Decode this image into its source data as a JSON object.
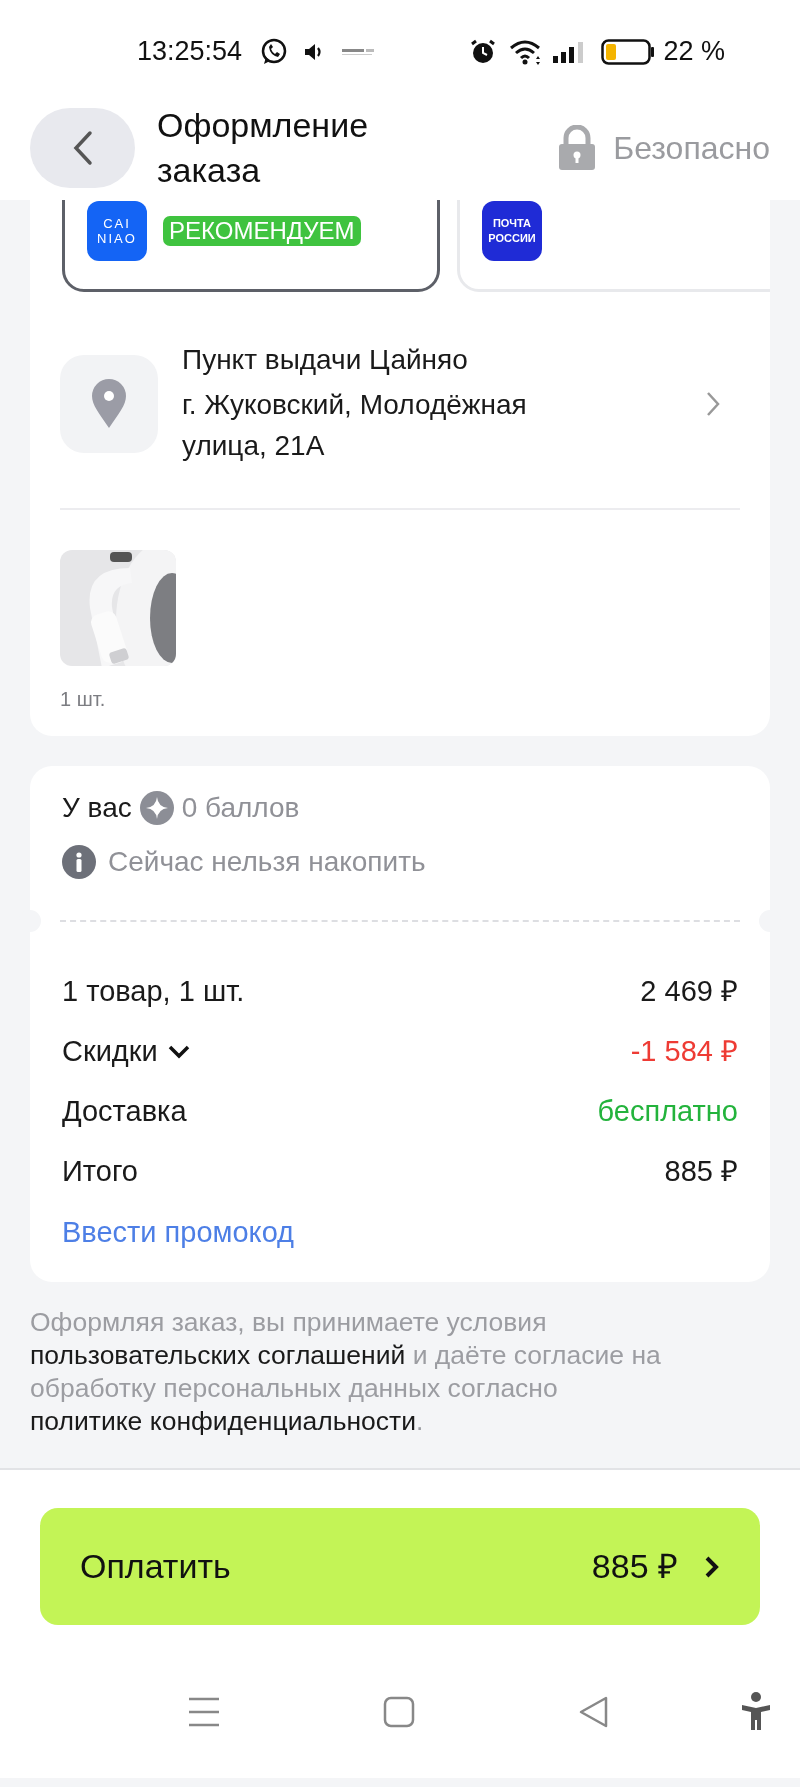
{
  "status_bar": {
    "time": "13:25:54",
    "battery_text": "22 %"
  },
  "header": {
    "title": "Оформление заказа",
    "secure_label": "Безопасно"
  },
  "delivery_options": [
    {
      "kind": "cainiao",
      "logo_lines": [
        "CAI",
        "NIAO"
      ],
      "badge": "РЕКОМЕНДУЕМ",
      "selected": true
    },
    {
      "kind": "pochta",
      "logo_lines": [
        "ПОЧТА",
        "РОССИИ"
      ],
      "selected": false
    }
  ],
  "pickup": {
    "title": "Пункт выдачи Цайняо",
    "address": "г. Жуковский, Молодёжная улица, 21А"
  },
  "product": {
    "kind": "picture",
    "quantity": "1 шт."
  },
  "points": {
    "prefix": "У вас",
    "value": "0 баллов",
    "note": "Сейчас нельзя накопить"
  },
  "summary": [
    {
      "kind": "plain",
      "label": "1 товар, 1 шт.",
      "value": "2 469 ₽"
    },
    {
      "kind": "discount",
      "label": "Скидки",
      "value": "-1 584 ₽",
      "expanded": false
    },
    {
      "kind": "free",
      "label": "Доставка",
      "value": "бесплатно"
    },
    {
      "kind": "plain",
      "label": "Итого",
      "value": "885 ₽"
    }
  ],
  "promo_link": "Ввести промокод",
  "legal": [
    {
      "text": "Оформляя заказ, вы принимаете условия ",
      "link": false
    },
    {
      "text": "пользовательских соглашений",
      "link": true
    },
    {
      "text": " и даёте согласие на обработку персональных данных согласно ",
      "link": false
    },
    {
      "text": "политике",
      "link": true
    },
    {
      "text": "конфиденциальности",
      "link": true
    },
    {
      "text": ".",
      "link": false
    }
  ],
  "pay_button": {
    "label": "Оплатить",
    "amount": "885 ₽"
  }
}
